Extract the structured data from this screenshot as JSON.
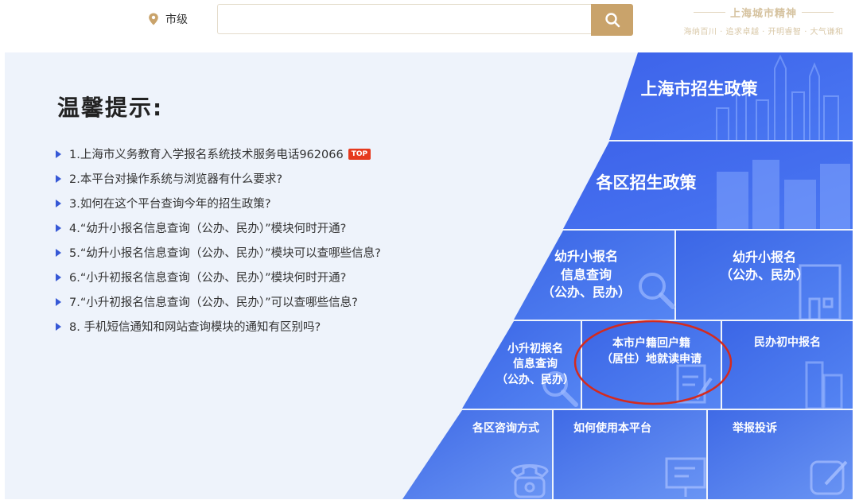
{
  "header": {
    "region_label": "市级",
    "search_placeholder": "",
    "slogan_title": "上海城市精神",
    "slogan_sub": "海纳百川 · 追求卓越 · 开明睿智 · 大气谦和"
  },
  "tips": {
    "title": "温馨提示:",
    "top_badge": "TOP",
    "items": [
      "1.上海市义务教育入学报名系统技术服务电话962066",
      "2.本平台对操作系统与浏览器有什么要求?",
      "3.如何在这个平台查询今年的招生政策?",
      "4.“幼升小报名信息查询（公办、民办）”模块何时开通?",
      "5.“幼升小报名信息查询（公办、民办）”模块可以查哪些信息?",
      "6.“小升初报名信息查询（公办、民办）”模块何时开通?",
      "7.“小升初报名信息查询（公办、民办）”可以查哪些信息?",
      "8. 手机短信通知和网站查询模块的通知有区别吗?"
    ]
  },
  "tiles": {
    "city_policy": "上海市招生政策",
    "district_policy": "各区招生政策",
    "k2p_query": "幼升小报名\n信息查询\n（公办、民办）",
    "k2p_register": "幼升小报名\n（公办、民办）",
    "p2m_query": "小升初报名\n信息查询\n（公办、民办）",
    "return_apply": "本市户籍回户籍\n（居住）地就读申请",
    "private_middle": "民办初中报名",
    "district_contact": "各区咨询方式",
    "how_to_use": "如何使用本平台",
    "report": "举报投诉"
  },
  "colors": {
    "accent_gold": "#c9a36b",
    "panel_bg": "#eef3fb",
    "tile_blue": "#3c68e8",
    "highlight_red": "#d42a1e"
  }
}
